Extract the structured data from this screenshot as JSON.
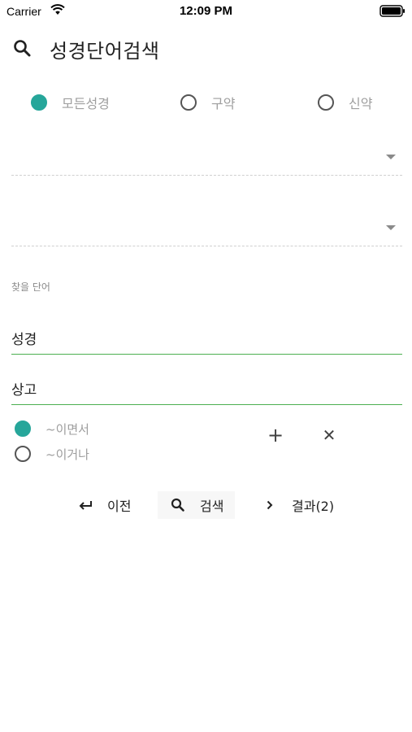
{
  "status_bar": {
    "carrier": "Carrier",
    "time": "12:09 PM"
  },
  "header": {
    "title": "성경단어검색",
    "icon": "search-icon"
  },
  "testament_options": [
    {
      "label": "모든성경",
      "checked": true
    },
    {
      "label": "구약",
      "checked": false
    },
    {
      "label": "신약",
      "checked": false
    }
  ],
  "dropdowns": [
    {
      "value": ""
    },
    {
      "value": ""
    }
  ],
  "search_words": {
    "label": "찾을 단어",
    "inputs": [
      {
        "value": "성경"
      },
      {
        "value": "상고"
      }
    ]
  },
  "logic_options": [
    {
      "label": "~이면서",
      "checked": true
    },
    {
      "label": "~이거나",
      "checked": false
    }
  ],
  "word_controls": {
    "add_glyph": "+",
    "remove_glyph": "✕"
  },
  "actions": {
    "prev": {
      "label": "이전",
      "icon": "return-arrow-icon"
    },
    "search": {
      "label": "검색",
      "icon": "search-icon"
    },
    "results": {
      "label": "결과(2)",
      "icon": "chevron-right-icon"
    }
  },
  "colors": {
    "accent": "#26a69a",
    "input_underline": "#4caf50",
    "muted_text": "#9e9e9e"
  }
}
